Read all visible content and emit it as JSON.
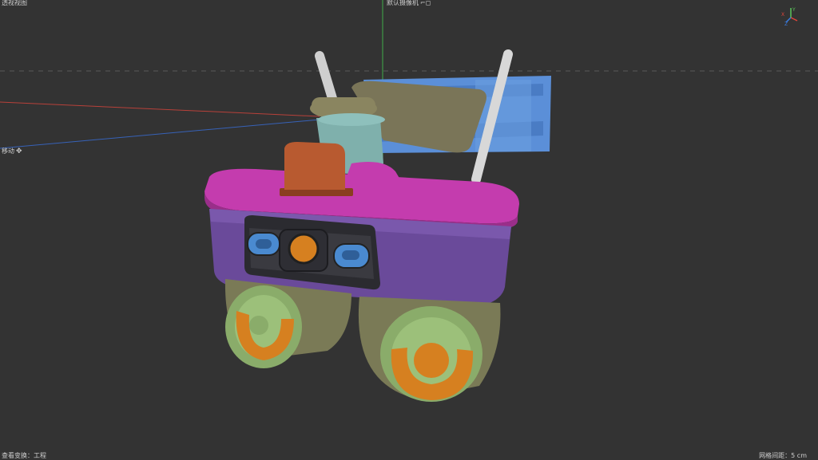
{
  "viewport": {
    "view_name": "透视视图",
    "camera_name": "默认摄像机",
    "camera_icon": "camera-icon",
    "tool_label": "移动",
    "tool_icon": "move-icon"
  },
  "status": {
    "left_text": "查看变换：工程",
    "grid_spacing": "网格间距：5 cm"
  },
  "gizmo": {
    "axes": [
      "X",
      "Y",
      "Z"
    ],
    "colors": {
      "x": "#e0443a",
      "y": "#5bc45b",
      "z": "#3a7be0"
    }
  },
  "colors": {
    "background": "#333333",
    "x_axis": "#b8413a",
    "y_axis": "#3fae4a",
    "z_axis": "#3762b8",
    "top_plate": "#c43cae",
    "body": "#6a4a9a",
    "bracket": "#5b8fd8",
    "dome": "#7a7a56",
    "lens_ring": "#d68020",
    "sensor": "#4a8ad0",
    "battery": "#b85a30"
  }
}
